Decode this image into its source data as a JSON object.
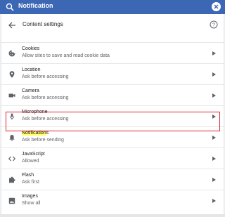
{
  "search": {
    "query_highlight": "",
    "query": "Notification"
  },
  "header": {
    "title": "Content settings"
  },
  "rows": [
    {
      "title": "Cookies",
      "subtitle": "Allow sites to save and read cookie data",
      "icon": "cookie-icon"
    },
    {
      "title": "Location",
      "subtitle": "Ask before accessing",
      "icon": "location-pin-icon"
    },
    {
      "title": "Camera",
      "subtitle": "Ask before accessing",
      "icon": "camera-icon"
    },
    {
      "title": "Microphone",
      "subtitle": "Ask before accessing",
      "icon": "microphone-icon"
    },
    {
      "title_highlight": "Notification",
      "title_rest": "s",
      "subtitle": "Ask before sending",
      "icon": "bell-icon"
    },
    {
      "title": "JavaScript",
      "subtitle": "Allowed",
      "icon": "code-brackets-icon"
    },
    {
      "title": "Flash",
      "subtitle": "Ask first",
      "icon": "puzzle-piece-icon"
    },
    {
      "title": "Images",
      "subtitle": "Show all",
      "icon": "image-icon"
    }
  ],
  "colors": {
    "topbar": "#3c67b5",
    "highlight": "#ffff66",
    "annotation_box": "#e0242f"
  }
}
